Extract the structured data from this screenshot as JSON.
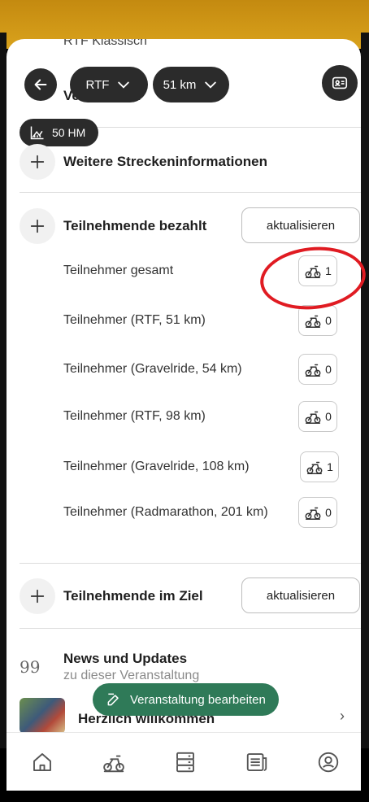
{
  "header": {
    "behind_text": "RTF Klassisch",
    "behind_title": "Veranstalter",
    "route_select": "RTF",
    "distance_select": "51 km",
    "elevation": "50 HM"
  },
  "sections": {
    "more_info": "Weitere Streckeninformationen",
    "paid": {
      "title": "Teilnehmende bezahlt",
      "refresh_label": "aktualisieren",
      "rows": [
        {
          "label": "Teilnehmer gesamt",
          "count": "1"
        },
        {
          "label": "Teilnehmer (RTF, 51 km)",
          "count": "0"
        },
        {
          "label": "Teilnehmer (Gravelride, 54 km)",
          "count": "0"
        },
        {
          "label": "Teilnehmer (RTF, 98 km)",
          "count": "0"
        },
        {
          "label": "Teilnehmer (Gravelride, 108 km)",
          "count": "1"
        },
        {
          "label": "Teilnehmer (Radmarathon, 201 km)",
          "count": "0"
        }
      ]
    },
    "finish": {
      "title": "Teilnehmende im Ziel",
      "refresh_label": "aktualisieren"
    },
    "news": {
      "quote_glyph": "99",
      "title": "News und Updates",
      "subtitle": "zu dieser Veranstaltung",
      "first_item": "Herzlich willkommen"
    }
  },
  "fab": {
    "label": "Veranstaltung bearbeiten"
  },
  "nav": [
    "home-icon",
    "bike-icon",
    "server-icon",
    "news-icon",
    "profile-icon"
  ],
  "colors": {
    "accent_green": "#2f7a58",
    "dark_pill": "#2b2b2b",
    "highlight_red": "#e01b22",
    "top_band": "#d9a21c"
  }
}
